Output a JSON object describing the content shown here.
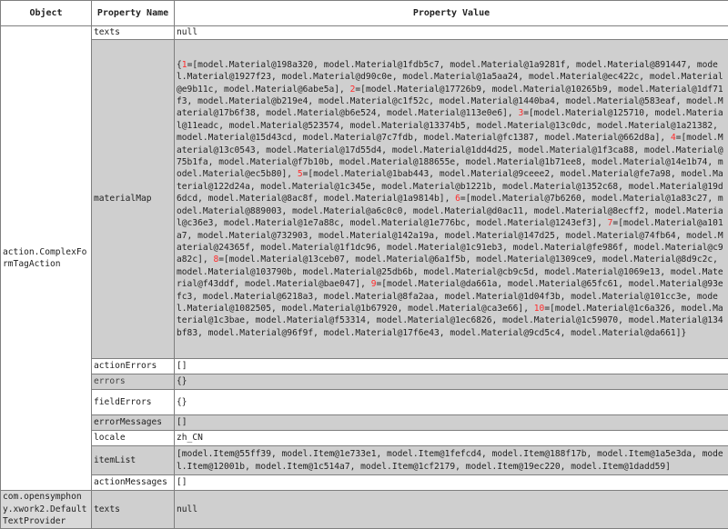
{
  "header": {
    "object": "Object",
    "property_name": "Property Name",
    "property_value": "Property Value"
  },
  "objects": [
    {
      "name": "action.ComplexFormTagAction"
    },
    {
      "name": "com.opensymphony.xwork2.DefaultTextProvider"
    }
  ],
  "rows_obj1": [
    {
      "name": "texts",
      "value": "null"
    },
    {
      "name": "materialMap"
    },
    {
      "name": "actionErrors",
      "value": "[]"
    },
    {
      "name": "errors",
      "value": "{}"
    },
    {
      "name": "fieldErrors",
      "value": "{}"
    },
    {
      "name": "errorMessages",
      "value": "[]"
    },
    {
      "name": "locale",
      "value": "zh_CN"
    },
    {
      "name": "itemList",
      "value": "[model.Item@55ff39, model.Item@1e733e1, model.Item@1fefcd4, model.Item@188f17b, model.Item@1a5e3da, model.Item@12001b, model.Item@1c514a7, model.Item@1cf2179, model.Item@19ec220, model.Item@1dadd59]"
    },
    {
      "name": "actionMessages",
      "value": "[]"
    }
  ],
  "material_map": {
    "open": "{",
    "close": "}",
    "entries": [
      {
        "key": "1",
        "text": "=[model.Material@198a320, model.Material@1fdb5c7, model.Material@1a9281f, model.Material@891447, model.Material@1927f23, model.Material@d90c0e, model.Material@1a5aa24, model.Material@ec422c, model.Material@e9b11c, model.Material@6abe5a], "
      },
      {
        "key": "2",
        "text": "=[model.Material@17726b9, model.Material@10265b9, model.Material@1df71f3, model.Material@b219e4, model.Material@c1f52c, model.Material@1440ba4, model.Material@583eaf, model.Material@17b6f38, model.Material@b6e524, model.Material@113e0e6], "
      },
      {
        "key": "3",
        "text": "=[model.Material@125710, model.Material@11eadc, model.Material@523574, model.Material@13374b5, model.Material@13c0dc, model.Material@1a21382, model.Material@15d43cd, model.Material@7c7fdb, model.Material@fc1387, model.Material@662d8a], "
      },
      {
        "key": "4",
        "text": "=[model.Material@13c0543, model.Material@17d55d4, model.Material@1dd4d25, model.Material@1f3ca88, model.Material@75b1fa, model.Material@f7b10b, model.Material@188655e, model.Material@1b71ee8, model.Material@14e1b74, model.Material@ec5b80], "
      },
      {
        "key": "5",
        "text": "=[model.Material@1bab443, model.Material@9ceee2, model.Material@fe7a98, model.Material@122d24a, model.Material@1c345e, model.Material@b1221b, model.Material@1352c68, model.Material@19d6dcd, model.Material@8ac8f, model.Material@1a9814b], "
      },
      {
        "key": "6",
        "text": "=[model.Material@7b6260, model.Material@1a83c27, model.Material@889003, model.Material@a6c0c0, model.Material@d0ac11, model.Material@8ecff2, model.Material@c36e3, model.Material@1e7a88c, model.Material@1e776bc, model.Material@1243ef3], "
      },
      {
        "key": "7",
        "text": "=[model.Material@a101a7, model.Material@732903, model.Material@142a19a, model.Material@147d25, model.Material@74fb64, model.Material@24365f, model.Material@1f1dc96, model.Material@1c91eb3, model.Material@fe986f, model.Material@c9a82c], "
      },
      {
        "key": "8",
        "text": "=[model.Material@13ceb07, model.Material@6a1f5b, model.Material@1309ce9, model.Material@8d9c2c, model.Material@103790b, model.Material@25db6b, model.Material@cb9c5d, model.Material@1069e13, model.Material@f43ddf, model.Material@bae047], "
      },
      {
        "key": "9",
        "text": "=[model.Material@da661a, model.Material@65fc61, model.Material@93efc3, model.Material@6218a3, model.Material@8fa2aa, model.Material@1d04f3b, model.Material@101cc3e, model.Material@1082505, model.Material@1b67920, model.Material@ca3e66], "
      },
      {
        "key": "10",
        "text": "=[model.Material@1c6a326, model.Material@1c3bae, model.Material@f53314, model.Material@1ec6826, model.Material@1c59070, model.Material@134bf83, model.Material@96f9f, model.Material@17f6e43, model.Material@9cd5c4, model.Material@da661]"
      }
    ]
  },
  "rows_obj2": [
    {
      "name": "texts",
      "value": "null"
    }
  ],
  "colors": {
    "row_shade": "#cfcfcf",
    "key_red": "#ff2a2a",
    "border": "#7f7f7f"
  }
}
